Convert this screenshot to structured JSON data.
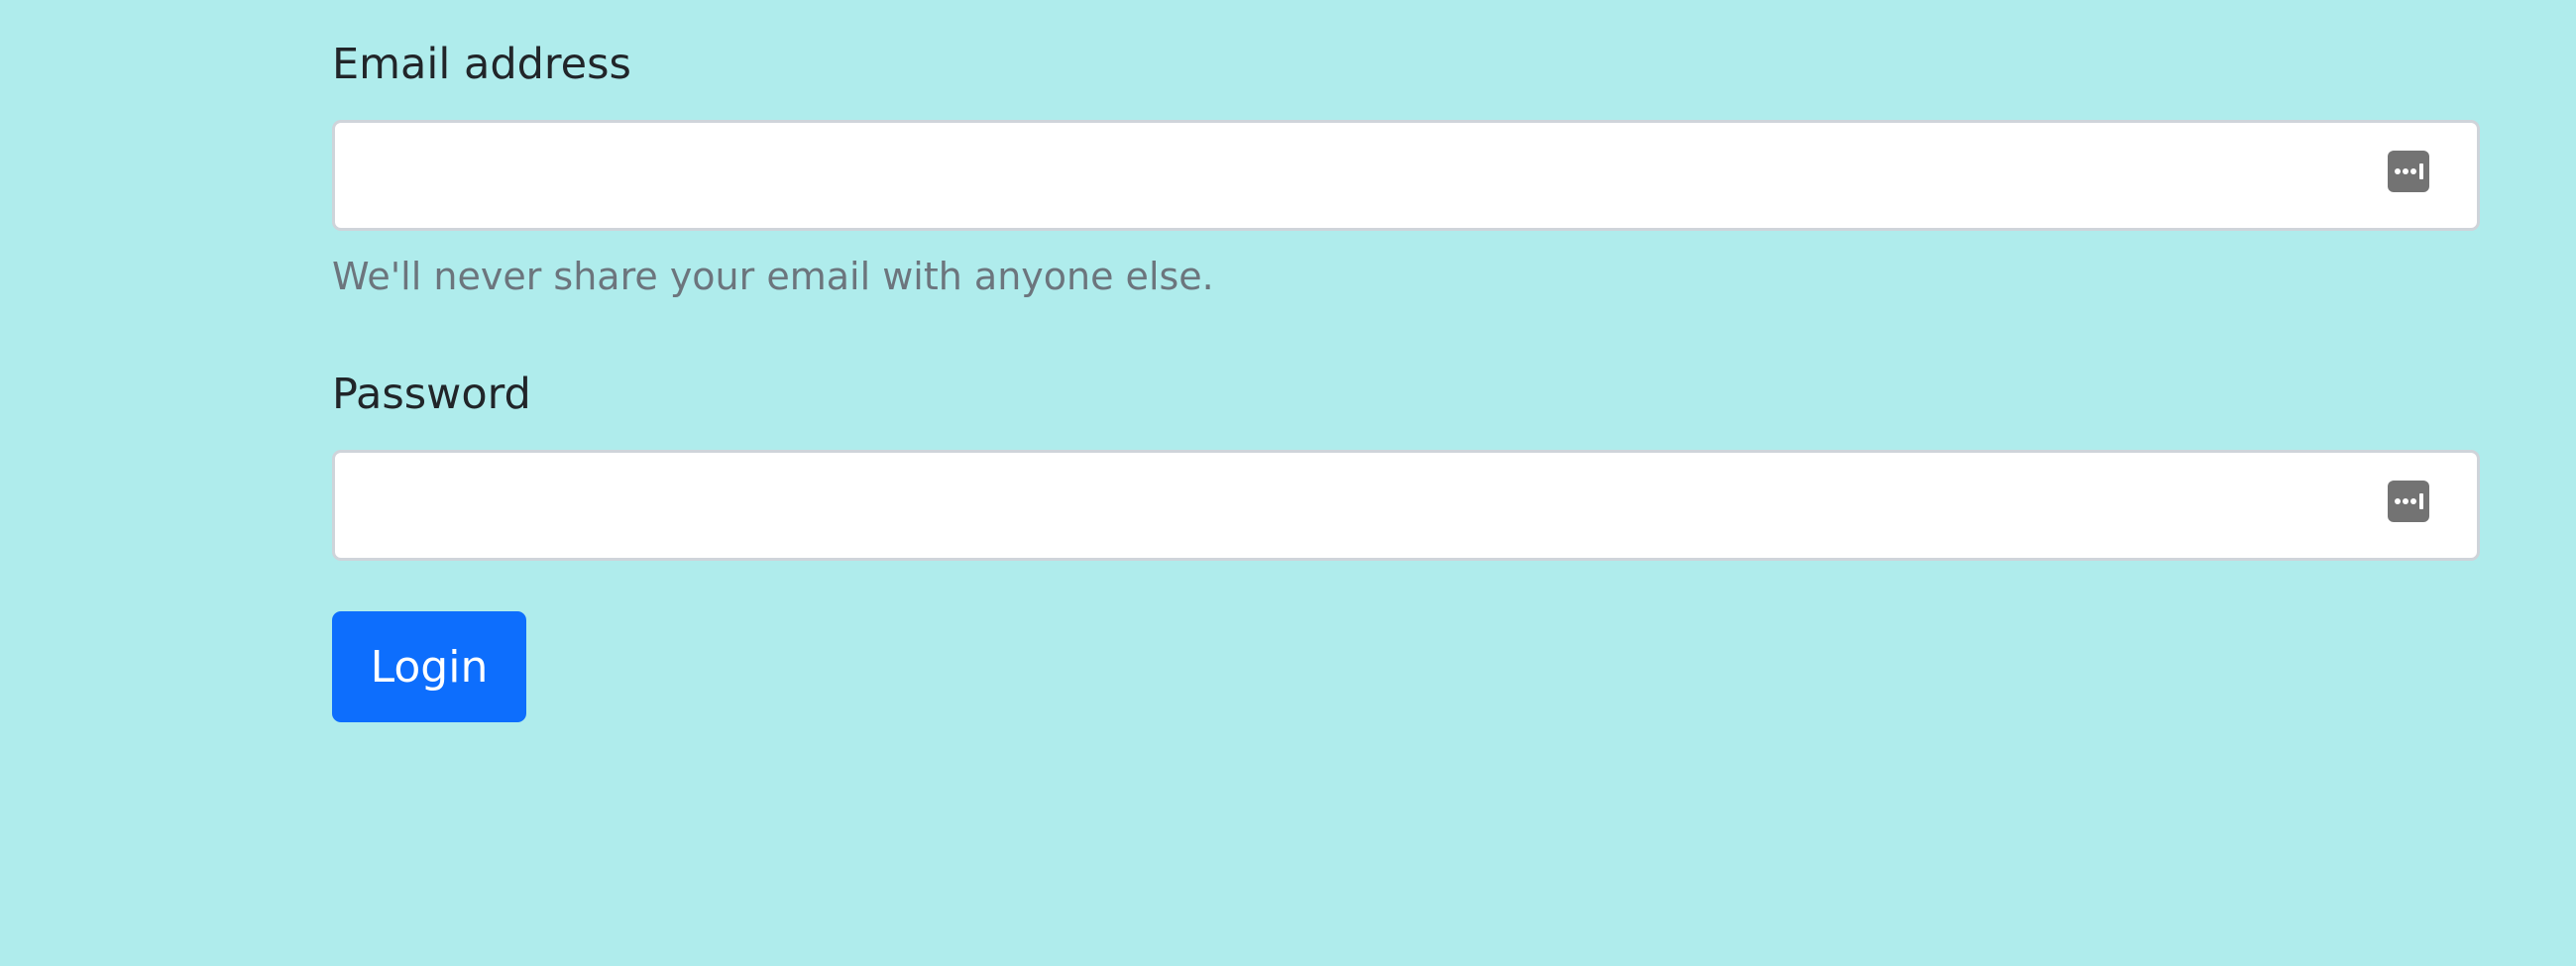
{
  "form": {
    "email": {
      "label": "Email address",
      "value": "",
      "placeholder": "",
      "help": "We'll never share your email with anyone else."
    },
    "password": {
      "label": "Password",
      "value": "",
      "placeholder": ""
    },
    "submit_label": "Login",
    "autofill_icon": "password-manager-icon"
  },
  "colors": {
    "background": "#afecec",
    "primary": "#0d6efd",
    "muted_text": "#6c757d"
  }
}
